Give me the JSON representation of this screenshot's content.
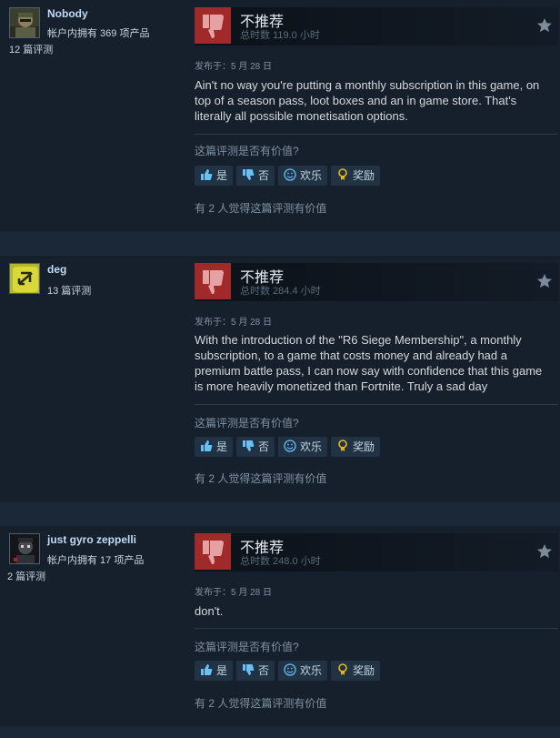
{
  "reviews": [
    {
      "author": {
        "name": "Nobody",
        "products_owned": "帐户内拥有 369 项产品",
        "review_count": "12 篇评测"
      },
      "verdict": "不推荐",
      "hours": "总时数 119.0 小时",
      "posted": "发布于：5 月 28 日",
      "content": "Ain't no way you're putting a monthly subscription in this game, on top of a season pass, loot boxes and an in game store. That's literally all possible monetisation options.",
      "helpful_question": "这篇评测是否有价值?",
      "buttons": {
        "yes": "是",
        "no": "否",
        "funny": "欢乐",
        "award": "奖励"
      },
      "helpful_count": "有 2 人觉得这篇评测有价值"
    },
    {
      "author": {
        "name": "deg",
        "review_count": "13 篇评测"
      },
      "verdict": "不推荐",
      "hours": "总时数 284.4 小时",
      "posted": "发布于：5 月 28 日",
      "content": "With the introduction of the \"R6 Siege Membership\", a monthly subscription, to a game that costs money and already had a premium battle pass, I can now say with confidence that this game is more heavily monetized than Fortnite. Truly a sad day",
      "helpful_question": "这篇评测是否有价值?",
      "buttons": {
        "yes": "是",
        "no": "否",
        "funny": "欢乐",
        "award": "奖励"
      },
      "helpful_count": "有 2 人觉得这篇评测有价值"
    },
    {
      "author": {
        "name": "just gyro zeppelli",
        "products_owned": "帐户内拥有 17 项产品",
        "review_count": "2 篇评测"
      },
      "verdict": "不推荐",
      "hours": "总时数 248.0 小时",
      "posted": "发布于：5 月 28 日",
      "content": "don't.",
      "helpful_question": "这篇评测是否有价值?",
      "buttons": {
        "yes": "是",
        "no": "否",
        "funny": "欢乐",
        "award": "奖励"
      },
      "helpful_count": "有 2 人觉得这篇评测有价值"
    }
  ],
  "colors": {
    "background": "#1b2838",
    "card": "#16202d",
    "thumb_down": "#a02a2a",
    "author_name": "#c1dbf4",
    "button": "#213244",
    "award_icon": "#e8b90c"
  }
}
